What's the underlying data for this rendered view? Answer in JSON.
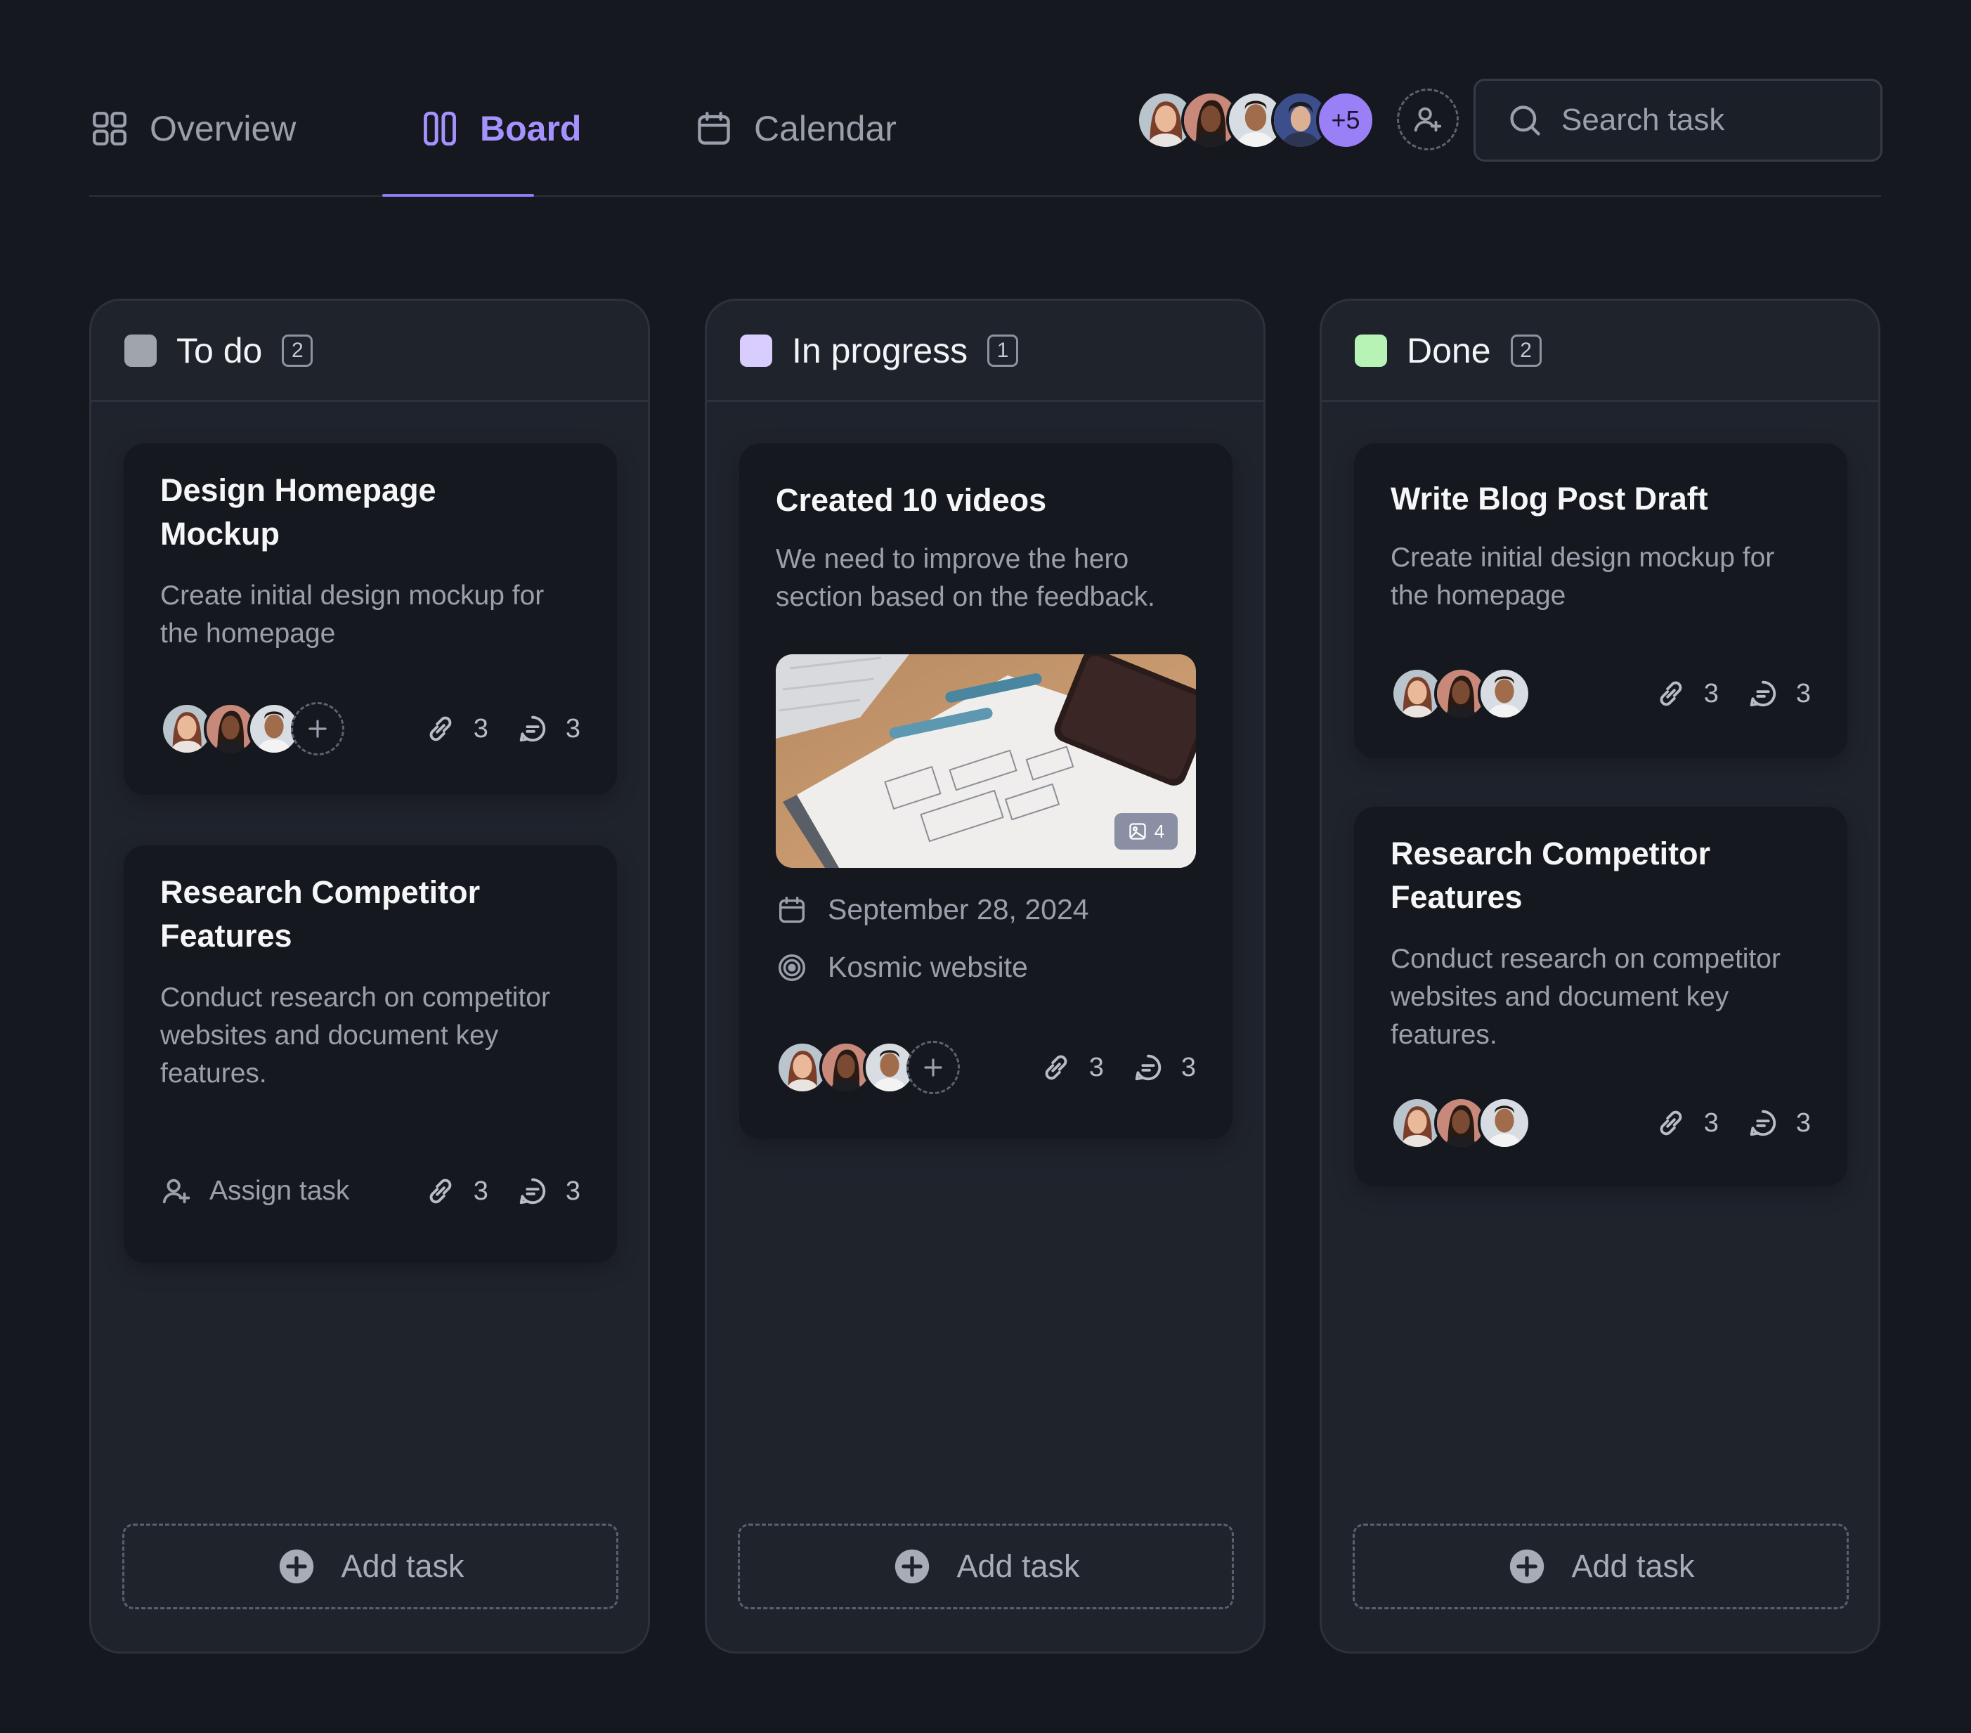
{
  "nav": {
    "tabs": [
      {
        "label": "Overview",
        "icon": "grid-icon"
      },
      {
        "label": "Board",
        "icon": "columns-icon",
        "active": true
      },
      {
        "label": "Calendar",
        "icon": "calendar-icon"
      }
    ],
    "team_more": "+5",
    "search_placeholder": "Search task"
  },
  "colors": {
    "background": "#15181e",
    "accent": "#a592ff",
    "todo": "#a0a4ad",
    "in_progress": "#d8cdfc",
    "done": "#b8f3b6"
  },
  "columns": [
    {
      "title": "To do",
      "count": "2",
      "cards": [
        {
          "title": "Design Homepage Mockup",
          "title_line1": "Design Homepage",
          "title_line2": "Mockup",
          "description_line1": "Create initial design mockup for",
          "description_line2": "the homepage",
          "links": "3",
          "comments": "3"
        },
        {
          "title_line1": "Research Competitor",
          "title_line2": "Features",
          "description_line1": "Conduct research on competitor",
          "description_line2": "websites and document key",
          "description_line3": "features.",
          "assign_label": "Assign task",
          "links": "3",
          "comments": "3"
        }
      ],
      "add_label": "Add task"
    },
    {
      "title": "In progress",
      "count": "1",
      "cards": [
        {
          "title": "Created 10 videos",
          "description_line1": "We need to improve the hero",
          "description_line2": "section based on the feedback.",
          "image_count": "4",
          "date": "September 28, 2024",
          "project": "Kosmic website",
          "links": "3",
          "comments": "3"
        }
      ],
      "add_label": "Add task"
    },
    {
      "title": "Done",
      "count": "2",
      "cards": [
        {
          "title": "Write Blog Post Draft",
          "description_line1": "Create initial design mockup for",
          "description_line2": "the homepage",
          "links": "3",
          "comments": "3"
        },
        {
          "title_line1": "Research Competitor",
          "title_line2": "Features",
          "description_line1": "Conduct research on competitor",
          "description_line2": "websites and document key",
          "description_line3": "features.",
          "links": "3",
          "comments": "3"
        }
      ],
      "add_label": "Add task"
    }
  ]
}
